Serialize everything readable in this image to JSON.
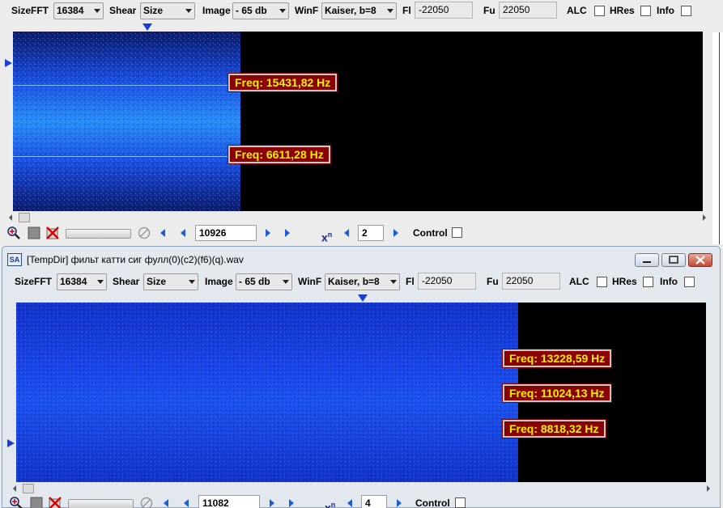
{
  "panel1": {
    "toolbar": {
      "sizefft_label": "SizeFFT",
      "sizefft_value": "16384",
      "shear_label": "Shear",
      "shear_value": "Size",
      "image_label": "Image",
      "image_value": "- 65 db",
      "winf_label": "WinF",
      "winf_value": "Kaiser, b=8",
      "fl_label": "Fl",
      "fl_value": "-22050",
      "fu_label": "Fu",
      "fu_value": "22050",
      "alc_label": "ALC",
      "hres_label": "HRes",
      "info_label": "Info"
    },
    "markers": [
      {
        "label": "Freq: 15431,82 Hz"
      },
      {
        "label": "Freq: 6611,28 Hz"
      }
    ],
    "controls": {
      "position_value": "10926",
      "x_label": "x",
      "x_sup": "n",
      "zoom_value": "2",
      "control_label": "Control"
    }
  },
  "panel2": {
    "title": "[TempDir] фильт катти сиг фулл(0)(c2)(f6)(q).wav",
    "app_icon_text": "SA",
    "toolbar": {
      "sizefft_label": "SizeFFT",
      "sizefft_value": "16384",
      "shear_label": "Shear",
      "shear_value": "Size",
      "image_label": "Image",
      "image_value": "- 65 db",
      "winf_label": "WinF",
      "winf_value": "Kaiser, b=8",
      "fl_label": "Fl",
      "fl_value": "-22050",
      "fu_label": "Fu",
      "fu_value": "22050",
      "alc_label": "ALC",
      "hres_label": "HRes",
      "info_label": "Info"
    },
    "markers": [
      {
        "label": "Freq: 13228,59 Hz"
      },
      {
        "label": "Freq: 11024,13 Hz"
      },
      {
        "label": "Freq: 8818,32 Hz"
      }
    ],
    "controls": {
      "position_value": "11082",
      "x_label": "x",
      "x_sup": "n",
      "zoom_value": "4",
      "control_label": "Control"
    }
  },
  "colors": {
    "spectrogram_bg": "#000000",
    "signal_blue": "#1a50e8",
    "tag_bg": "#8b0000",
    "tag_text": "#f5f000"
  }
}
